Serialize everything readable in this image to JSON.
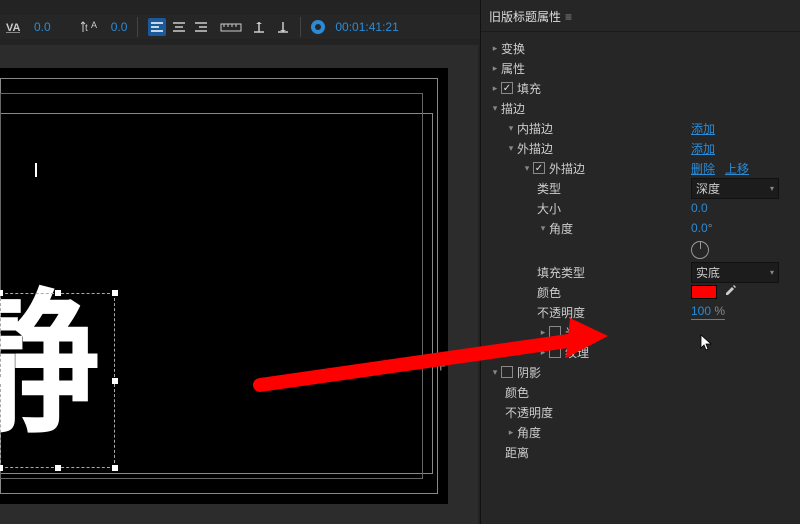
{
  "toolbar": {
    "va_value": "0.0",
    "ta_value": "0.0",
    "timecode": "00:01:41:21"
  },
  "canvas": {
    "text_content": "静"
  },
  "panel": {
    "title": "旧版标题属性",
    "transform": "变换",
    "properties": "属性",
    "fill": "填充",
    "stroke": "描边",
    "inner_stroke": "内描边",
    "outer_stroke": "外描边",
    "outer_stroke_item": "外描边",
    "add": "添加",
    "delete": "删除",
    "move_up": "上移",
    "type_label": "类型",
    "type_value": "深度",
    "size_label": "大小",
    "size_value": "0.0",
    "angle_label": "角度",
    "angle_value": "0.0",
    "angle_unit": "°",
    "fill_type_label": "填充类型",
    "fill_type_value": "实底",
    "color_label": "颜色",
    "opacity_label": "不透明度",
    "opacity_value": "100",
    "opacity_unit": " %",
    "sheen": "光泽",
    "texture": "纹理",
    "shadow": "阴影",
    "s_color": "颜色",
    "s_opacity": "不透明度",
    "s_angle": "角度",
    "s_distance": "距离"
  }
}
